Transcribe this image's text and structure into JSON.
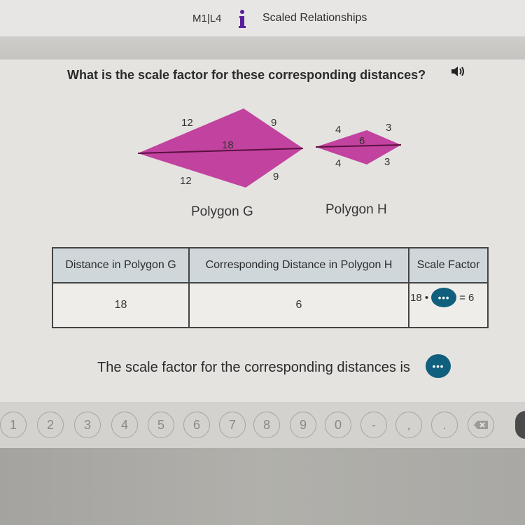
{
  "header": {
    "lesson": "M1|L4",
    "lesson_icon": "info-i-icon",
    "title": "Scaled Relationships",
    "accent_color": "#5b1f9e"
  },
  "question": {
    "text": "What is the scale factor for these corresponding distances?",
    "audio_icon": "speaker-icon"
  },
  "figure": {
    "polygon_g": {
      "label": "Polygon G",
      "sides": {
        "top_left": "12",
        "top_right": "9",
        "bottom_left": "12",
        "bottom_right": "9"
      },
      "diagonal": "18"
    },
    "polygon_h": {
      "label": "Polygon H",
      "sides": {
        "top_left": "4",
        "top_right": "3",
        "bottom_left": "4",
        "bottom_right": "3"
      },
      "diagonal": "6"
    },
    "fill_color": "#c2429f"
  },
  "table": {
    "headers": [
      "Distance in Polygon G",
      "Corresponding Distance in Polygon H",
      "Scale Factor"
    ],
    "rows": [
      {
        "g": "18",
        "h": "6",
        "sf_left": "18 •",
        "sf_button": "•••",
        "sf_right": "= 6"
      }
    ]
  },
  "answer": {
    "text": "The scale factor for the corresponding distances is",
    "button": "•••",
    "button_color": "#0f5f7d"
  },
  "keypad": {
    "keys": [
      "1",
      "2",
      "3",
      "4",
      "5",
      "6",
      "7",
      "8",
      "9",
      "0",
      "-",
      ",",
      ".",
      "⌫"
    ]
  }
}
